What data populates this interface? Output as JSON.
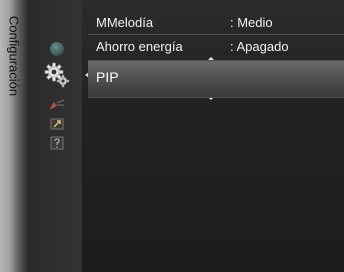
{
  "side_tab": {
    "label": "Configuración"
  },
  "menu": {
    "rows": [
      {
        "label": "MMelodía",
        "value": ": Medio"
      },
      {
        "label": "Ahorro energía",
        "value": ": Apagado"
      }
    ],
    "selected": {
      "label": "PIP"
    }
  },
  "icons": [
    "disc-icon",
    "gear-icon",
    "antenna-icon",
    "input-icon",
    "help-icon"
  ],
  "colors": {
    "background": "#000000",
    "panel": "#222222",
    "highlight": "#5a5a5a",
    "text": "#f1f1f1",
    "tab": "#9e9e9e"
  }
}
